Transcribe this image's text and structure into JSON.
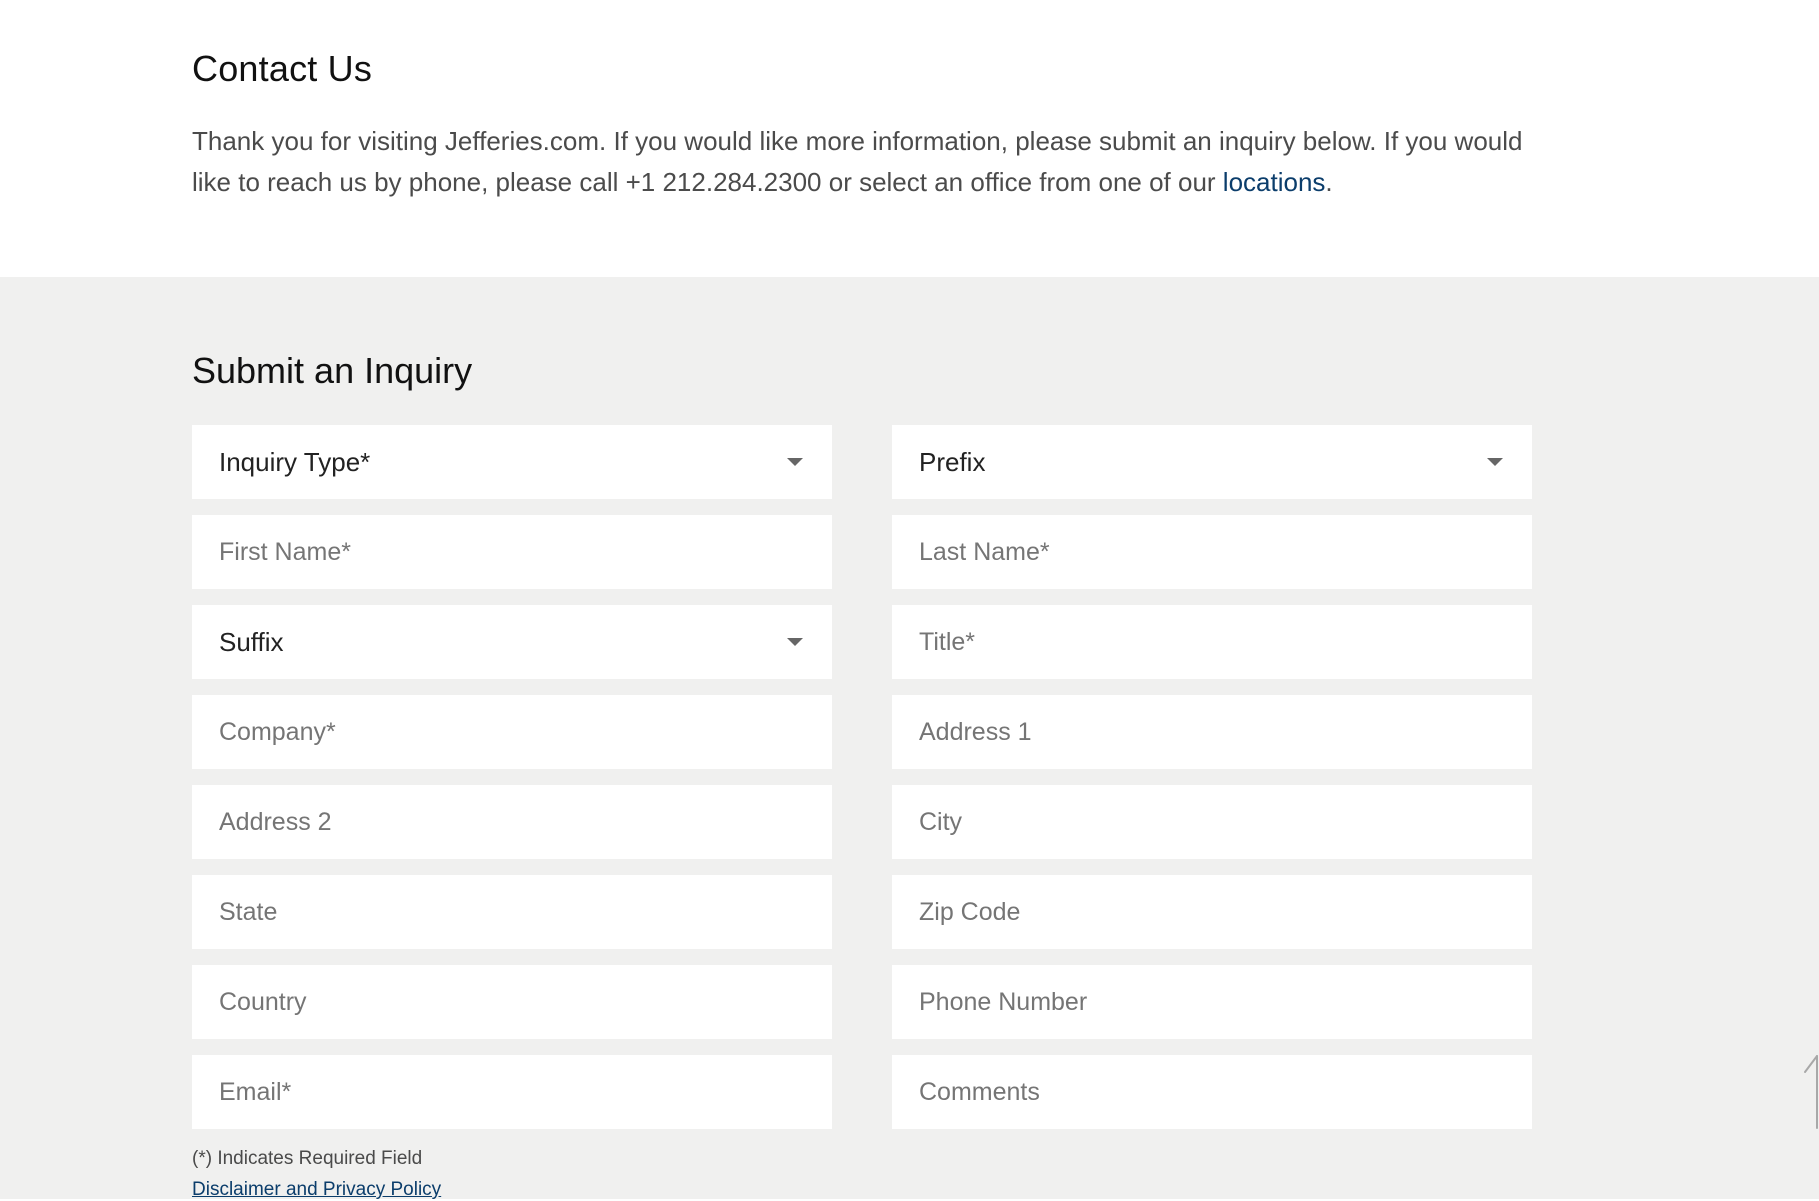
{
  "contact": {
    "title": "Contact Us",
    "text_before_link": "Thank you for visiting Jefferies.com. If you would like more information, please submit an inquiry below. If you would like to reach us by phone, please call +1 212.284.2300 or select an office from one of our ",
    "link_text": "locations",
    "text_after_link": "."
  },
  "inquiry": {
    "title": "Submit an Inquiry",
    "fields": {
      "inquiry_type": {
        "label": "Inquiry Type*",
        "icon": "chevron-down-icon"
      },
      "prefix": {
        "label": "Prefix",
        "icon": "chevron-down-icon"
      },
      "first_name": {
        "placeholder": "First Name*",
        "value": ""
      },
      "last_name": {
        "placeholder": "Last Name*",
        "value": ""
      },
      "suffix": {
        "label": "Suffix",
        "icon": "chevron-down-icon"
      },
      "title": {
        "placeholder": "Title*",
        "value": ""
      },
      "company": {
        "placeholder": "Company*",
        "value": ""
      },
      "address1": {
        "placeholder": "Address 1",
        "value": ""
      },
      "address2": {
        "placeholder": "Address 2",
        "value": ""
      },
      "city": {
        "placeholder": "City",
        "value": ""
      },
      "state": {
        "placeholder": "State",
        "value": ""
      },
      "zip": {
        "placeholder": "Zip Code",
        "value": ""
      },
      "country": {
        "placeholder": "Country",
        "value": ""
      },
      "phone": {
        "placeholder": "Phone Number",
        "value": ""
      },
      "email": {
        "placeholder": "Email*",
        "value": ""
      },
      "comments": {
        "placeholder": "Comments",
        "value": ""
      }
    },
    "required_note": "(*) Indicates Required Field",
    "policy_link": "Disclaimer and Privacy Policy"
  },
  "colors": {
    "link": "#0b3d6b",
    "section_background": "#f0f0ef",
    "field_background": "#ffffff"
  },
  "icons": {
    "scroll_up": "arrow-up-icon"
  }
}
